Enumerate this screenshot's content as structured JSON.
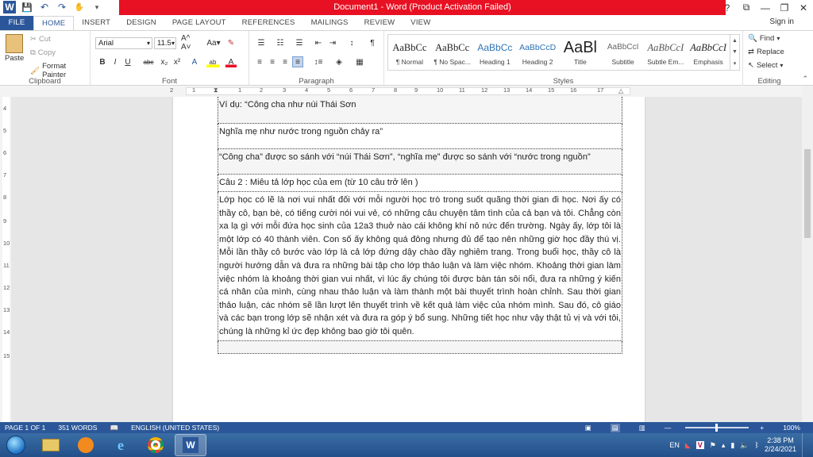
{
  "window": {
    "title": "Document1  -  Word (Product Activation Failed)"
  },
  "window_controls": {
    "help": "?",
    "ribbon_display": "⧉",
    "minimize": "—",
    "restore": "❐",
    "close": "✕"
  },
  "qat": {
    "word_icon": "W",
    "save_icon": "💾",
    "undo_icon": "↶",
    "redo_icon": "↷",
    "touch_icon": "✋",
    "customize_icon": "▾"
  },
  "tabs": [
    "FILE",
    "HOME",
    "INSERT",
    "DESIGN",
    "PAGE LAYOUT",
    "REFERENCES",
    "MAILINGS",
    "REVIEW",
    "VIEW"
  ],
  "signin": "Sign in",
  "clipboard": {
    "paste": "Paste",
    "cut": "Cut",
    "copy": "Copy",
    "format_painter": "Format Painter",
    "label": "Clipboard"
  },
  "font": {
    "name": "Arial",
    "size": "11.5",
    "label": "Font",
    "buttons": [
      "B",
      "I",
      "U",
      "abc",
      "x₂",
      "x²",
      "A",
      "ab",
      "A"
    ]
  },
  "paragraph": {
    "label": "Paragraph",
    "pilcrow": "¶"
  },
  "styles": {
    "label": "Styles",
    "items": [
      {
        "sample": "AaBbCc",
        "name": "¶ Normal"
      },
      {
        "sample": "AaBbCc",
        "name": "¶ No Spac..."
      },
      {
        "sample": "AaBbCc",
        "name": "Heading 1"
      },
      {
        "sample": "AaBbCcD",
        "name": "Heading 2"
      },
      {
        "sample": "AaBl",
        "name": "Title"
      },
      {
        "sample": "AaBbCcI",
        "name": "Subtitle"
      },
      {
        "sample": "AaBbCcI",
        "name": "Subtle Em..."
      },
      {
        "sample": "AaBbCcI",
        "name": "Emphasis"
      }
    ]
  },
  "editing": {
    "label": "Editing",
    "find": "Find",
    "replace": "Replace",
    "select": "Select"
  },
  "ruler": {
    "numbers": [
      "2",
      "1",
      "1",
      "2",
      "3",
      "4",
      "5",
      "6",
      "7",
      "8",
      "9",
      "10",
      "11",
      "12",
      "13",
      "14",
      "15",
      "16",
      "17"
    ]
  },
  "vruler": {
    "numbers": [
      "4",
      "5",
      "6",
      "7",
      "8",
      "9",
      "10",
      "11",
      "12",
      "13",
      "14",
      "15"
    ]
  },
  "document": {
    "rows": [
      "Ví dụ: “Công cha như núi Thái Sơn",
      "Nghĩa mẹ như nước trong nguồn chảy ra”",
      "“Công cha” được so sánh với “núi Thái Sơn”, “nghĩa mẹ” được so sánh với “nước trong nguồn”",
      "Câu 2 : Miêu tả lớp học của em (từ 10 câu trở lên )",
      "Lớp học có lẽ là nơi vui nhất đối với mỗi người học trò trong suốt quãng thời gian đi học. Nơi ấy có thầy cô, bạn bè, có tiếng cười nói vui vẻ, có những câu chuyện tâm tình của cả bạn và tôi. Chẳng còn xa lạ gì với mỗi đứa học sinh của 12a3 thuở nào cái không khí nô nức đến trường. Ngày ấy, lớp tôi là một lớp có 40 thành viên. Con số ấy không quá đông nhưng đủ để tạo nên những giờ học đầy thú vị. Mỗi lần thầy cô bước vào lớp là cả lớp đứng dậy chào đầy nghiêm trang. Trong buổi học, thầy cô là người hướng dẫn và đưa ra những bài tập cho lớp thảo luận và làm việc nhóm. Khoảng thời gian làm việc nhóm là khoảng thời gian vui nhất, vì lúc ấy chúng tôi được bàn tán sôi nổi, đưa ra những ý kiến cá nhân của mình, cùng nhau thảo luận và làm thành một bài thuyết  trình hoàn chỉnh. Sau thời gian thảo luận, các nhóm sẽ lần lượt lên thuyết trình về kết quả làm việc của nhóm mình. Sau đó, cô giáo và các bạn trong lớp sẽ nhận xét và đưa ra góp ý bổ sung. Những tiết học như vậy thật tủ vị và với tôi, chúng là những kỉ ức đẹp không bao giờ tôi quên.",
      ""
    ]
  },
  "status": {
    "page": "PAGE 1 OF 1",
    "words": "351 WORDS",
    "language": "ENGLISH (UNITED STATES)",
    "zoom": "100%"
  },
  "taskbar": {
    "lang": "EN",
    "time": "2:38 PM",
    "date": "2/24/2021"
  },
  "colors": {
    "accent": "#2b579a",
    "title_bar_red": "#e81123"
  }
}
